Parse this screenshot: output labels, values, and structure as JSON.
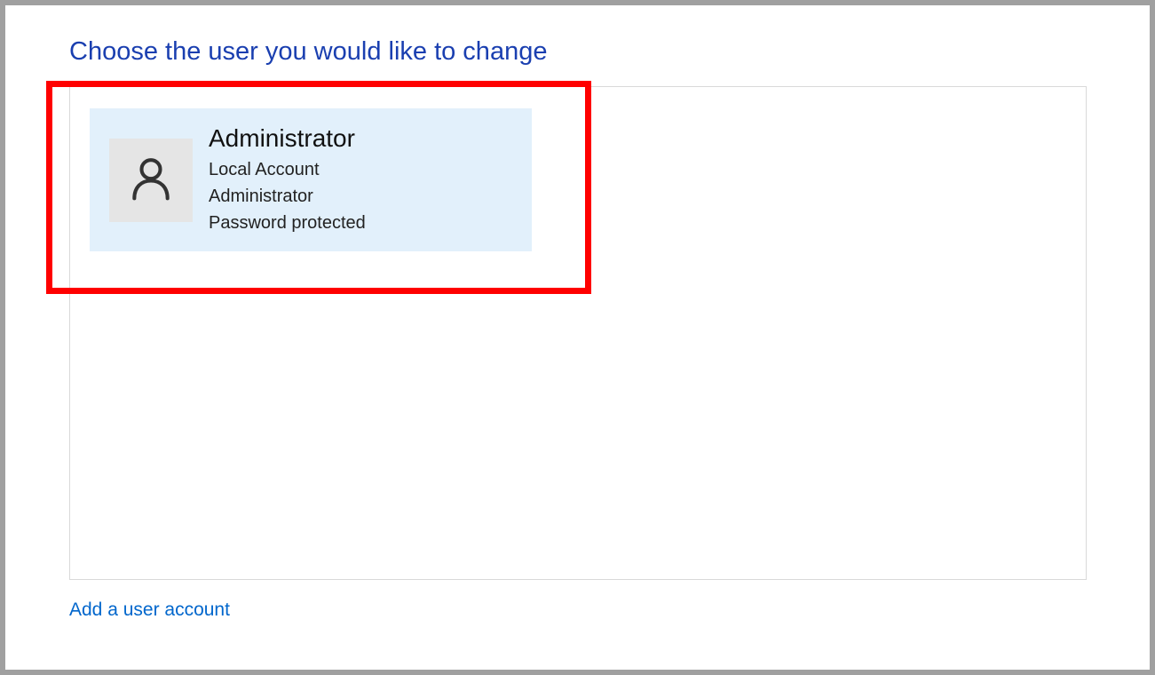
{
  "page": {
    "title": "Choose the user you would like to change"
  },
  "users": [
    {
      "name": "Administrator",
      "account_type": "Local Account",
      "role": "Administrator",
      "password_status": "Password protected"
    }
  ],
  "links": {
    "add_account": "Add a user account"
  }
}
